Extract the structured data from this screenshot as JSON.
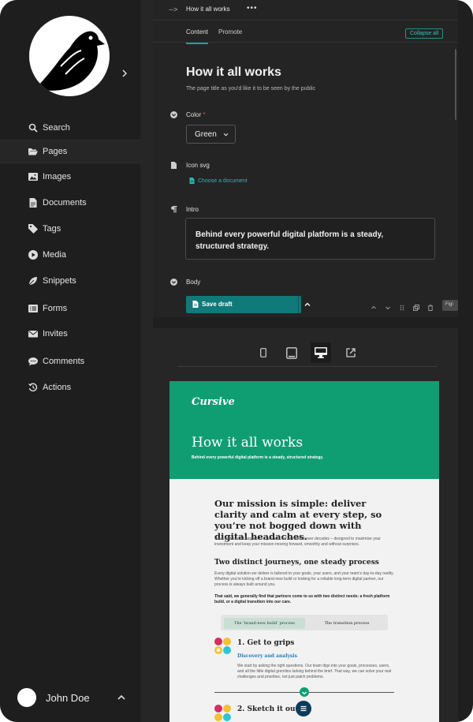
{
  "sidebar": {
    "expand_icon": "chevron-right-icon",
    "items": [
      {
        "label": "Search",
        "icon": "search-icon"
      },
      {
        "label": "Pages",
        "icon": "folder-open-icon",
        "active": true
      },
      {
        "label": "Images",
        "icon": "image-icon"
      },
      {
        "label": "Documents",
        "icon": "document-icon"
      },
      {
        "label": "Tags",
        "icon": "tag-icon"
      },
      {
        "label": "Media",
        "icon": "play-icon"
      },
      {
        "label": "Snippets",
        "icon": "leaf-icon"
      },
      {
        "label": "Forms",
        "icon": "list-icon"
      },
      {
        "label": "Invites",
        "icon": "mail-icon"
      },
      {
        "label": "Comments",
        "icon": "comment-icon"
      },
      {
        "label": "Actions",
        "icon": "history-icon"
      }
    ],
    "user": {
      "name": "John Doe"
    }
  },
  "editor": {
    "back_arrow": "-->",
    "breadcrumb_title": "How it all works",
    "more": "•••",
    "tabs": [
      {
        "label": "Content",
        "active": true
      },
      {
        "label": "Promote",
        "active": false
      }
    ],
    "collapse_all": "Collapse all",
    "title": "How it all works",
    "title_help": "The page title as you'd like it to be seen by the public",
    "fields": {
      "color": {
        "label": "Color",
        "required_mark": "*",
        "value": "Green"
      },
      "icon_svg": {
        "label": "Icon svg",
        "action": "Choose a document"
      },
      "intro": {
        "label": "Intro",
        "value": "Behind every powerful digital platform is a steady, structured strategy."
      },
      "body": {
        "label": "Body"
      }
    },
    "save_draft": "Save draft",
    "tooltip_fragment": "Figi",
    "accent": "#0f7a79"
  },
  "preview": {
    "devices": [
      "mobile-icon",
      "tablet-icon",
      "desktop-icon",
      "external-link-icon"
    ],
    "active_device": "desktop",
    "site": {
      "brand": "Cursive",
      "hero_title": "How it all works",
      "hero_subtitle": "Behind every powerful digital platform is a steady, structured strategy.",
      "mission": "Our mission is simple: deliver clarity and calm at every step, so you’re not bogged down with digital headaches.",
      "mission_body": "What makes that happen is a process we’ve refined over decades – designed to maximise your investment and keep your mission moving forward, smoothly and without surprises.",
      "journeys_title": "Two distinct journeys, one steady process",
      "journeys_body": "Every digital solution we deliver is tailored to your goals, your users, and your team’s day-to-day reality. Whether you’re kicking off a brand-new build or looking for a reliable long-term digital partner, our process is always built around you.",
      "journeys_bold": "That said, we generally find that partners come to us with two distinct needs: a fresh platform build, or a digital transition into our care.",
      "toggle": [
        "The ‘brand-new build’ process",
        "The transition process"
      ],
      "step1_title": "1. Get to grips",
      "step1_sub": "Discovery and analysis",
      "step1_body": "We start by asking the right questions. Our team digs into your goals, processes, users, and all the little digital gremlins lurking behind the brief. That way, we can solve your real challenges and priorities, not just patch problems.",
      "step2_title": "2. Sketch it out",
      "hero_color": "#0f9e72"
    }
  }
}
